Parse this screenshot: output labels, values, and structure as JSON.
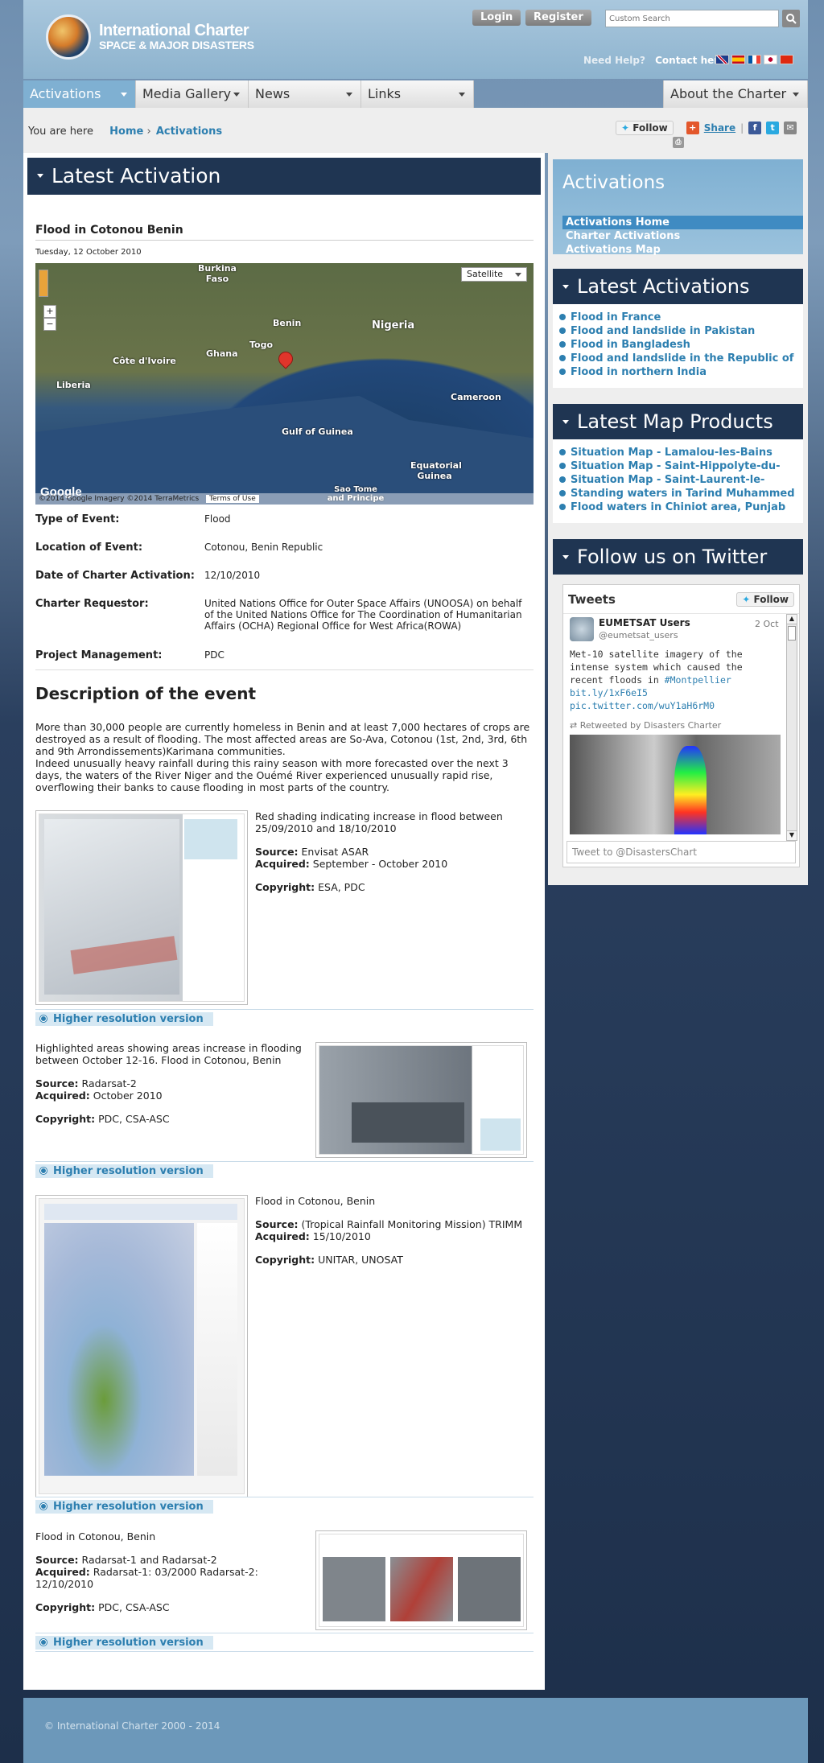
{
  "header": {
    "logo_line1": "International Charter",
    "logo_line2": "SPACE & MAJOR DISASTERS",
    "login": "Login",
    "register": "Register",
    "search_placeholder": "Custom Search",
    "need_help": "Need Help?",
    "contact": "Contact here"
  },
  "nav": {
    "items": [
      "Activations",
      "Media Gallery",
      "News",
      "Links",
      "About the Charter"
    ]
  },
  "breadcrumb": {
    "you_are_here": "You are here",
    "home": "Home",
    "sep": "›",
    "current": "Activations"
  },
  "share": {
    "follow": "Follow",
    "share": "Share"
  },
  "main": {
    "heading": "Latest Activation",
    "title": "Flood in Cotonou Benin",
    "date": "Tuesday, 12 October 2010",
    "map": {
      "satellite": "Satellite",
      "attribution": "©2014 Google Imagery ©2014 TerraMetrics",
      "terms": "Terms of Use",
      "google": "Google",
      "labels": [
        "Burkina Faso",
        "Benin",
        "Nigeria",
        "Togo",
        "Ghana",
        "Côte d'Ivoire",
        "Liberia",
        "Cameroon",
        "Gulf of Guinea",
        "Equatorial Guinea",
        "Sao Tome and Principe"
      ]
    },
    "details": [
      {
        "label": "Type of Event:",
        "value": "Flood"
      },
      {
        "label": "Location of Event:",
        "value": "Cotonou, Benin Republic"
      },
      {
        "label": "Date of Charter Activation:",
        "value": "12/10/2010"
      },
      {
        "label": "Charter Requestor:",
        "value": "United Nations Office for Outer Space Affairs (UNOOSA) on behalf of the United Nations Office for The Coordination of Humanitarian Affairs (OCHA) Regional Office for West Africa(ROWA)"
      },
      {
        "label": "Project Management:",
        "value": "PDC"
      }
    ],
    "desc_heading": "Description of the event",
    "desc_p1": "More than 30,000 people are currently homeless in Benin and at least 7,000 hectares of crops are destroyed as a result of flooding. The most affected areas are So-Ava, Cotonou (1st, 2nd, 3rd, 6th and 9th Arrondissements)Karimana communities.",
    "desc_p2": "Indeed unusually heavy rainfall during this rainy season with more forecasted over the next 3 days, the waters of the River Niger and the Ouémé River experienced unusually rapid rise, overflowing their banks to cause flooding in most parts of the country.",
    "source_label": "Source:",
    "acquired_label": "Acquired:",
    "copyright_label": "Copyright:",
    "hires": "Higher resolution version",
    "products": [
      {
        "caption": "Red shading indicating increase in flood between 25/09/2010 and 18/10/2010",
        "source": "Envisat ASAR",
        "acquired": "September - October 2010",
        "copyright": "ESA, PDC"
      },
      {
        "caption": "Highlighted areas showing areas increase in flooding between October 12-16. Flood in Cotonou, Benin",
        "source": "Radarsat-2",
        "acquired": "October 2010",
        "copyright": "PDC, CSA-ASC"
      },
      {
        "caption": "Flood in Cotonou, Benin",
        "source": "(Tropical Rainfall Monitoring Mission) TRIMM",
        "acquired": "15/10/2010",
        "copyright": "UNITAR, UNOSAT"
      },
      {
        "caption": "Flood in Cotonou, Benin",
        "source": "Radarsat-1 and Radarsat-2",
        "acquired": "Radarsat-1: 03/2000 Radarsat-2: 12/10/2010",
        "copyright": "PDC, CSA-ASC"
      }
    ]
  },
  "sidebar": {
    "activations_title": "Activations",
    "activations_links": [
      "Activations Home",
      "Charter Activations",
      "Activations Map"
    ],
    "latest_activations_title": "Latest Activations",
    "latest_activations": [
      "Flood in France",
      "Flood and landslide in Pakistan",
      "Flood in Bangladesh",
      "Flood and landslide in the Republic of",
      "Flood in northern India"
    ],
    "latest_maps_title": "Latest Map Products",
    "latest_maps": [
      "Situation Map - Lamalou-les-Bains",
      "Situation Map - Saint-Hippolyte-du-",
      "Situation Map - Saint-Laurent-le-",
      "Standing waters in Tarind Muhammed",
      "Flood waters in Chiniot area, Punjab"
    ],
    "twitter_title": "Follow us on Twitter"
  },
  "twitter": {
    "tweets": "Tweets",
    "follow": "Follow",
    "name": "EUMETSAT Users",
    "handle": "@eumetsat_users",
    "date": "2 Oct",
    "body": "Met-10 satellite imagery of the intense system which caused the recent floods in ",
    "hashtag": "#Montpellier",
    "link1": "bit.ly/1xF6eI5",
    "link2": "pic.twitter.com/wuY1aH6rM0",
    "retweeted": "Retweeted by Disasters Charter",
    "tweet_to": "Tweet to @DisastersChart"
  },
  "footer": {
    "copyright": "© International Charter 2000 - 2014"
  },
  "colors": {
    "accent": "#2d7fb0",
    "header_bar": "#1f3552",
    "nav_active": "#7fb0d2"
  }
}
